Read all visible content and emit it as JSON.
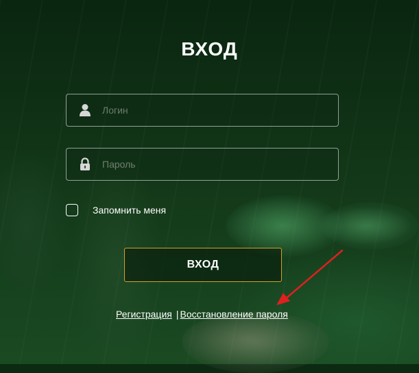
{
  "page": {
    "title": "ВХОД"
  },
  "form": {
    "login_placeholder": "Логин",
    "password_placeholder": "Пароль",
    "remember_label": "Запомнить меня",
    "submit_label": "ВХОД"
  },
  "links": {
    "register_label": "Регистрация",
    "separator": "|",
    "recover_label": "Восстановление пароля"
  },
  "icons": {
    "login_field": "user-icon",
    "password_field": "lock-icon",
    "annotation": "red-arrow-icon"
  },
  "colors": {
    "button_border": "#d4a22a",
    "annotation_arrow": "#e0201e",
    "text": "#ffffff"
  }
}
